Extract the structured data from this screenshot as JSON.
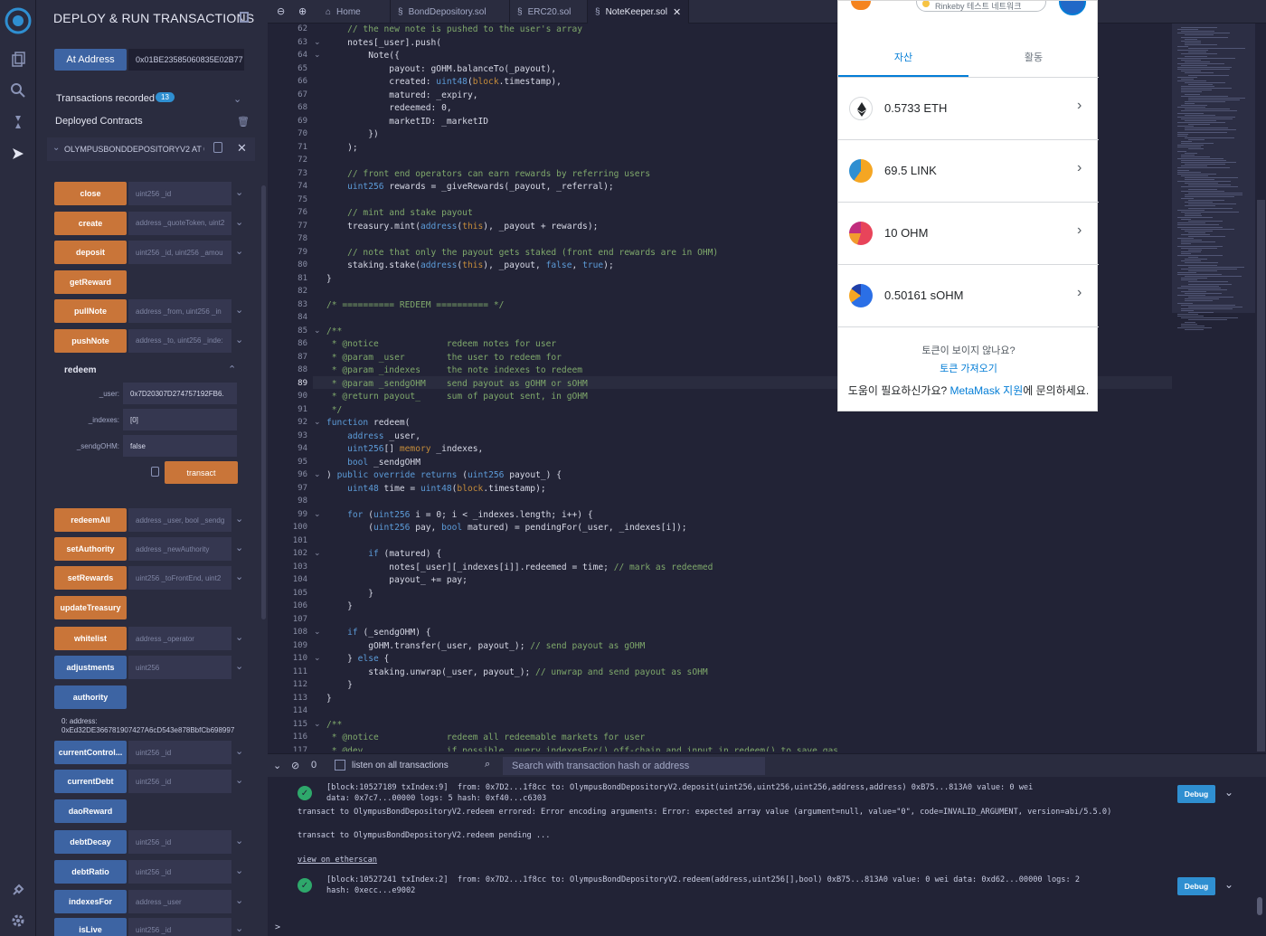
{
  "panel": {
    "title": "DEPLOY & RUN TRANSACTIONS",
    "at_address_label": "At Address",
    "at_address_value": "0x01BE23585060835E02B77",
    "transactions_recorded_label": "Transactions recorded",
    "transactions_count": "13",
    "deployed_contracts_label": "Deployed Contracts",
    "instance_name": "OLYMPUSBONDDEPOSITORYV2 AT 0",
    "functions_top": [
      {
        "label": "close",
        "style": "orange",
        "param": "uint256 _id"
      },
      {
        "label": "create",
        "style": "orange",
        "param": "address _quoteToken, uint2"
      },
      {
        "label": "deposit",
        "style": "orange",
        "param": "uint256 _id, uint256 _amou"
      },
      {
        "label": "getReward",
        "style": "orange",
        "param": ""
      },
      {
        "label": "pullNote",
        "style": "orange",
        "param": "address _from, uint256 _in"
      },
      {
        "label": "pushNote",
        "style": "orange",
        "param": "address _to, uint256 _inde:"
      }
    ],
    "redeem": {
      "title": "redeem",
      "params": [
        {
          "label": "_user:",
          "value": "0x7D20307D274757192FB6."
        },
        {
          "label": "_indexes:",
          "value": "[0]"
        },
        {
          "label": "_sendgOHM:",
          "value": "false"
        }
      ],
      "transact_label": "transact"
    },
    "functions_bottom": [
      {
        "label": "redeemAll",
        "style": "orange",
        "param": "address _user, bool _sendg"
      },
      {
        "label": "setAuthority",
        "style": "orange",
        "param": "address _newAuthority"
      },
      {
        "label": "setRewards",
        "style": "orange",
        "param": "uint256 _toFrontEnd, uint2"
      },
      {
        "label": "updateTreasury",
        "style": "orange",
        "param": ""
      },
      {
        "label": "whitelist",
        "style": "orange",
        "param": "address _operator"
      },
      {
        "label": "adjustments",
        "style": "blue",
        "param": "uint256"
      },
      {
        "label": "authority",
        "style": "blue",
        "param": ""
      }
    ],
    "authority_output": "0:  address: 0xEd32DE366781907427A6cD543e878BbfCb698997",
    "functions_tail": [
      {
        "label": "currentControl...",
        "style": "blue",
        "param": "uint256 _id"
      },
      {
        "label": "currentDebt",
        "style": "blue",
        "param": "uint256 _id"
      },
      {
        "label": "daoReward",
        "style": "blue",
        "param": ""
      },
      {
        "label": "debtDecay",
        "style": "blue",
        "param": "uint256 _id"
      },
      {
        "label": "debtRatio",
        "style": "blue",
        "param": "uint256 _id"
      },
      {
        "label": "indexesFor",
        "style": "blue",
        "param": "address _user"
      },
      {
        "label": "isLive",
        "style": "blue",
        "param": "uint256 _id"
      }
    ]
  },
  "tabs": [
    {
      "label": "Home",
      "active": false
    },
    {
      "label": "BondDepository.sol",
      "active": false
    },
    {
      "label": "ERC20.sol",
      "active": false
    },
    {
      "label": "NoteKeeper.sol",
      "active": true
    }
  ],
  "editor": {
    "current_line": "89",
    "lines": [
      {
        "n": "62",
        "t": "    // the new note is pushed to the user's array",
        "fold": false
      },
      {
        "n": "63",
        "t": "    notes[_user].push(",
        "fold": true
      },
      {
        "n": "64",
        "t": "        Note({",
        "fold": true
      },
      {
        "n": "65",
        "t": "            payout: gOHM.balanceTo(_payout),",
        "fold": false
      },
      {
        "n": "66",
        "t": "            created: uint48(block.timestamp),",
        "fold": false
      },
      {
        "n": "67",
        "t": "            matured: _expiry,",
        "fold": false
      },
      {
        "n": "68",
        "t": "            redeemed: 0,",
        "fold": false
      },
      {
        "n": "69",
        "t": "            marketID: _marketID",
        "fold": false
      },
      {
        "n": "70",
        "t": "        })",
        "fold": false
      },
      {
        "n": "71",
        "t": "    );",
        "fold": false
      },
      {
        "n": "72",
        "t": "",
        "fold": false
      },
      {
        "n": "73",
        "t": "    // front end operators can earn rewards by referring users",
        "fold": false
      },
      {
        "n": "74",
        "t": "    uint256 rewards = _giveRewards(_payout, _referral);",
        "fold": false
      },
      {
        "n": "75",
        "t": "",
        "fold": false
      },
      {
        "n": "76",
        "t": "    // mint and stake payout",
        "fold": false
      },
      {
        "n": "77",
        "t": "    treasury.mint(address(this), _payout + rewards);",
        "fold": false
      },
      {
        "n": "78",
        "t": "",
        "fold": false
      },
      {
        "n": "79",
        "t": "    // note that only the payout gets staked (front end rewards are in OHM)",
        "fold": false
      },
      {
        "n": "80",
        "t": "    staking.stake(address(this), _payout, false, true);",
        "fold": false
      },
      {
        "n": "81",
        "t": "}",
        "fold": false
      },
      {
        "n": "82",
        "t": "",
        "fold": false
      },
      {
        "n": "83",
        "t": "/* ========== REDEEM ========== */",
        "fold": false
      },
      {
        "n": "84",
        "t": "",
        "fold": false
      },
      {
        "n": "85",
        "t": "/**",
        "fold": true
      },
      {
        "n": "86",
        "t": " * @notice             redeem notes for user",
        "fold": false
      },
      {
        "n": "87",
        "t": " * @param _user        the user to redeem for",
        "fold": false
      },
      {
        "n": "88",
        "t": " * @param _indexes     the note indexes to redeem",
        "fold": false
      },
      {
        "n": "89",
        "t": " * @param _sendgOHM    send payout as gOHM or sOHM",
        "fold": false
      },
      {
        "n": "90",
        "t": " * @return payout_     sum of payout sent, in gOHM",
        "fold": false
      },
      {
        "n": "91",
        "t": " */",
        "fold": false
      },
      {
        "n": "92",
        "t": "function redeem(",
        "fold": true
      },
      {
        "n": "93",
        "t": "    address _user,",
        "fold": false
      },
      {
        "n": "94",
        "t": "    uint256[] memory _indexes,",
        "fold": false
      },
      {
        "n": "95",
        "t": "    bool _sendgOHM",
        "fold": false
      },
      {
        "n": "96",
        "t": ") public override returns (uint256 payout_) {",
        "fold": true
      },
      {
        "n": "97",
        "t": "    uint48 time = uint48(block.timestamp);",
        "fold": false
      },
      {
        "n": "98",
        "t": "",
        "fold": false
      },
      {
        "n": "99",
        "t": "    for (uint256 i = 0; i < _indexes.length; i++) {",
        "fold": true
      },
      {
        "n": "100",
        "t": "        (uint256 pay, bool matured) = pendingFor(_user, _indexes[i]);",
        "fold": false
      },
      {
        "n": "101",
        "t": "",
        "fold": false
      },
      {
        "n": "102",
        "t": "        if (matured) {",
        "fold": true
      },
      {
        "n": "103",
        "t": "            notes[_user][_indexes[i]].redeemed = time; // mark as redeemed",
        "fold": false
      },
      {
        "n": "104",
        "t": "            payout_ += pay;",
        "fold": false
      },
      {
        "n": "105",
        "t": "        }",
        "fold": false
      },
      {
        "n": "106",
        "t": "    }",
        "fold": false
      },
      {
        "n": "107",
        "t": "",
        "fold": false
      },
      {
        "n": "108",
        "t": "    if (_sendgOHM) {",
        "fold": true
      },
      {
        "n": "109",
        "t": "        gOHM.transfer(_user, payout_); // send payout as gOHM",
        "fold": false
      },
      {
        "n": "110",
        "t": "    } else {",
        "fold": true
      },
      {
        "n": "111",
        "t": "        staking.unwrap(_user, payout_); // unwrap and send payout as sOHM",
        "fold": false
      },
      {
        "n": "112",
        "t": "    }",
        "fold": false
      },
      {
        "n": "113",
        "t": "}",
        "fold": false
      },
      {
        "n": "114",
        "t": "",
        "fold": false
      },
      {
        "n": "115",
        "t": "/**",
        "fold": true
      },
      {
        "n": "116",
        "t": " * @notice             redeem all redeemable markets for user",
        "fold": false
      },
      {
        "n": "117",
        "t": " * @dev                if possible, query indexesFor() off-chain and input in redeem() to save gas",
        "fold": false
      }
    ]
  },
  "terminal": {
    "pending_count": "0",
    "listen_label": "listen on all transactions",
    "search_placeholder": "Search with transaction hash or address",
    "entries": [
      "[block:10527189 txIndex:9]  from: 0x7D2...1f8cc to: OlympusBondDepositoryV2.deposit(uint256,uint256,uint256,address,address) 0xB75...813A0 value: 0 wei",
      "data: 0x7c7...00000 logs: 5 hash: 0xf40...c6303",
      "transact to OlympusBondDepositoryV2.redeem errored: Error encoding arguments: Error: expected array value (argument=null, value=\"0\", code=INVALID_ARGUMENT, version=abi/5.5.0)",
      "transact to OlympusBondDepositoryV2.redeem pending ...",
      "view on etherscan",
      "[block:10527241 txIndex:2]  from: 0x7D2...1f8cc to: OlympusBondDepositoryV2.redeem(address,uint256[],bool) 0xB75...813A0 value: 0 wei data: 0xd62...00000 logs: 2",
      "hash: 0xecc...e9002"
    ],
    "debug_label": "Debug",
    "prompt": ">"
  },
  "metamask": {
    "network": "Rinkeby 테스트 네트워크",
    "tab_assets": "자산",
    "tab_activity": "활동",
    "assets": [
      {
        "name": "0.5733 ETH",
        "color": "#ffffff"
      },
      {
        "name": "69.5 LINK",
        "color": "#f5a623"
      },
      {
        "name": "10 OHM",
        "color": "#e8445a"
      },
      {
        "name": "0.50161 sOHM",
        "color": "#2b6fe6"
      }
    ],
    "no_token_question": "토큰이 보이지 않나요?",
    "import_tokens": "토큰 가져오기",
    "help_prefix": "도움이 필요하신가요? ",
    "help_link": "MetaMask 지원",
    "help_suffix": "에 문의하세요."
  }
}
